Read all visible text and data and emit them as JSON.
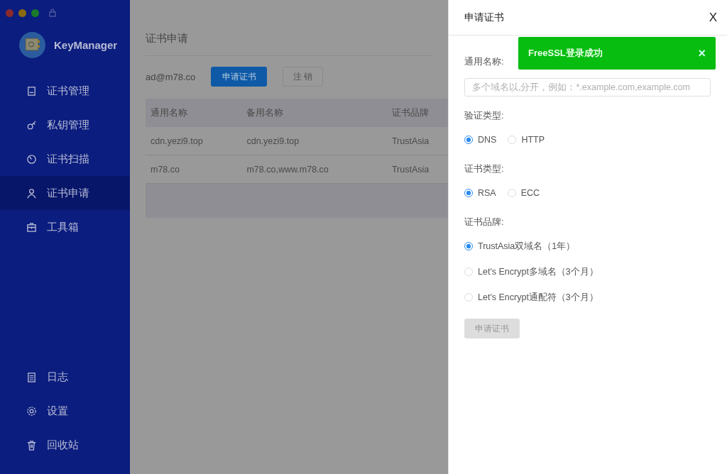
{
  "app": {
    "name": "KeyManager"
  },
  "sidebar": {
    "items": [
      {
        "label": "证书管理",
        "selected": false
      },
      {
        "label": "私钥管理",
        "selected": false
      },
      {
        "label": "证书扫描",
        "selected": false
      },
      {
        "label": "证书申请",
        "selected": true
      },
      {
        "label": "工具箱",
        "selected": false
      }
    ],
    "bottom_items": [
      {
        "label": "日志",
        "selected": false
      },
      {
        "label": "设置",
        "selected": false
      },
      {
        "label": "回收站",
        "selected": false
      }
    ]
  },
  "page": {
    "title": "证书申请",
    "account": "ad@m78.co",
    "apply_button": "申请证书",
    "logout_button": "注 销",
    "table": {
      "columns": [
        "通用名称",
        "备用名称",
        "证书品牌"
      ],
      "rows": [
        [
          "cdn.yezi9.top",
          "cdn.yezi9.top",
          "TrustAsia"
        ],
        [
          "m78.co",
          "m78.co,www.m78.co",
          "TrustAsia"
        ]
      ]
    }
  },
  "drawer": {
    "title": "申请证书",
    "close": "X",
    "fields": [
      {
        "kind": "input",
        "label": "通用名称:",
        "placeholder": "多个域名以,分开，例如：*.example.com,example.com"
      },
      {
        "kind": "radio",
        "label": "验证类型:",
        "options": [
          {
            "label": "DNS",
            "selected": true
          },
          {
            "label": "HTTP",
            "selected": false
          }
        ]
      },
      {
        "kind": "radio",
        "label": "证书类型:",
        "options": [
          {
            "label": "RSA",
            "selected": true
          },
          {
            "label": "ECC",
            "selected": false
          }
        ]
      },
      {
        "kind": "radiolist",
        "label": "证书品牌:",
        "options": [
          {
            "label": "TrustAsia双域名（1年）",
            "selected": true
          },
          {
            "label": "Let's Encrypt多域名（3个月）",
            "selected": false
          },
          {
            "label": "Let's Encrypt通配符（3个月）",
            "selected": false
          }
        ]
      }
    ],
    "submit": {
      "label": "申请证书",
      "disabled": true
    }
  },
  "toast": {
    "message": "FreeSSL登录成功",
    "close": "×"
  }
}
